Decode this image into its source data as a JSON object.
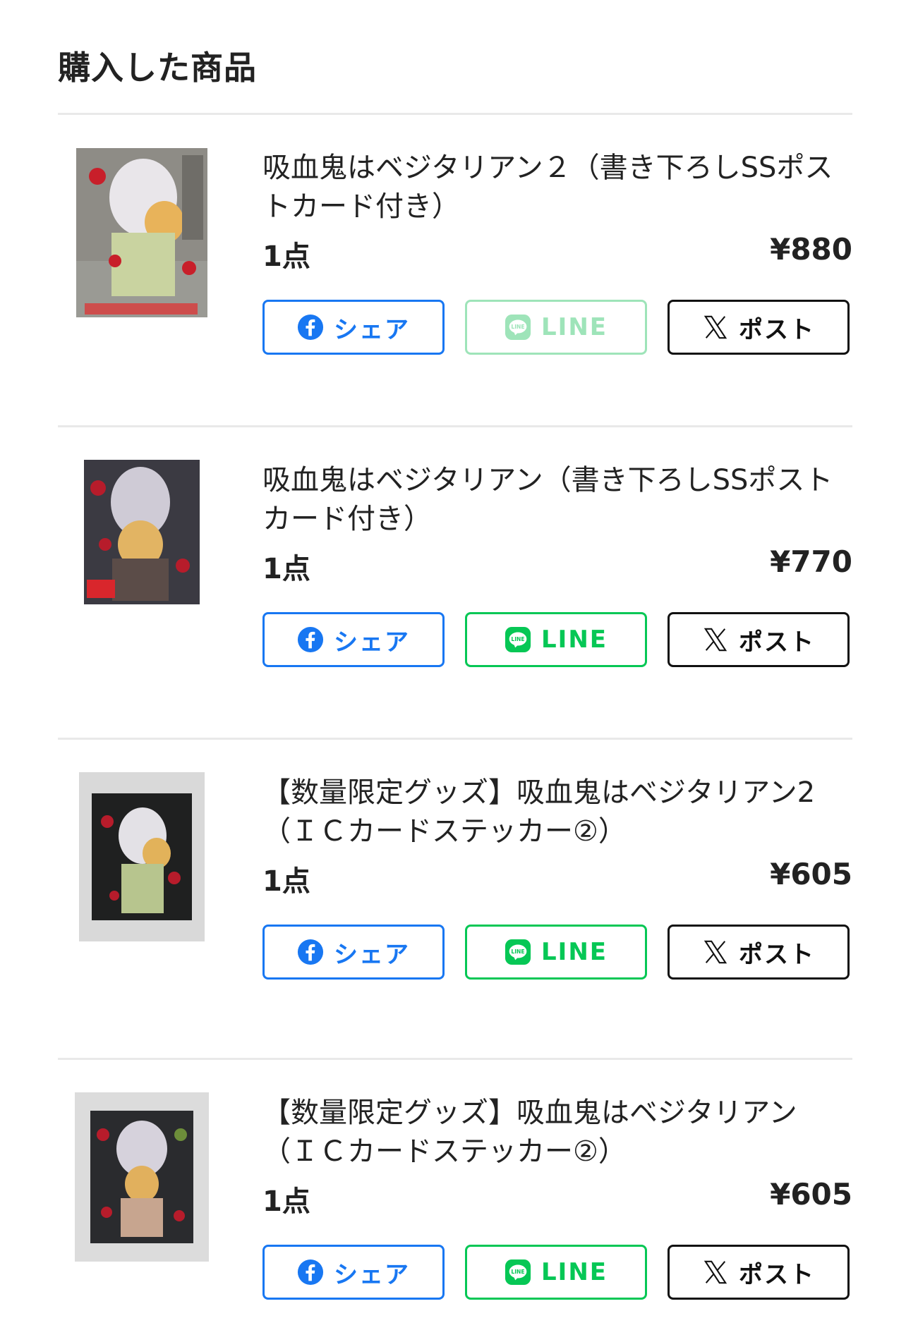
{
  "page": {
    "heading": "購入した商品"
  },
  "colors": {
    "facebook": "#1877f2",
    "line": "#06c755",
    "x": "#111111",
    "divider": "#e9e9e9"
  },
  "share_buttons": {
    "facebook": "シェア",
    "line": "LINE",
    "x": "ポスト"
  },
  "items": [
    {
      "title": "吸血鬼はベジタリアン２（書き下ろしSSポストカード付き）",
      "quantity": "1点",
      "price": "¥880",
      "image": "book-cover-vol2",
      "line_disabled": true
    },
    {
      "title": "吸血鬼はベジタリアン（書き下ろしSSポストカード付き）",
      "quantity": "1点",
      "price": "¥770",
      "image": "book-cover-vol1",
      "line_disabled": false
    },
    {
      "title": "【数量限定グッズ】吸血鬼はベジタリアン2（ＩＣカードステッカー②）",
      "quantity": "1点",
      "price": "¥605",
      "image": "sticker-vol2",
      "line_disabled": false
    },
    {
      "title": "【数量限定グッズ】吸血鬼はベジタリアン（ＩＣカードステッカー②）",
      "quantity": "1点",
      "price": "¥605",
      "image": "sticker-vol1",
      "line_disabled": false
    }
  ]
}
